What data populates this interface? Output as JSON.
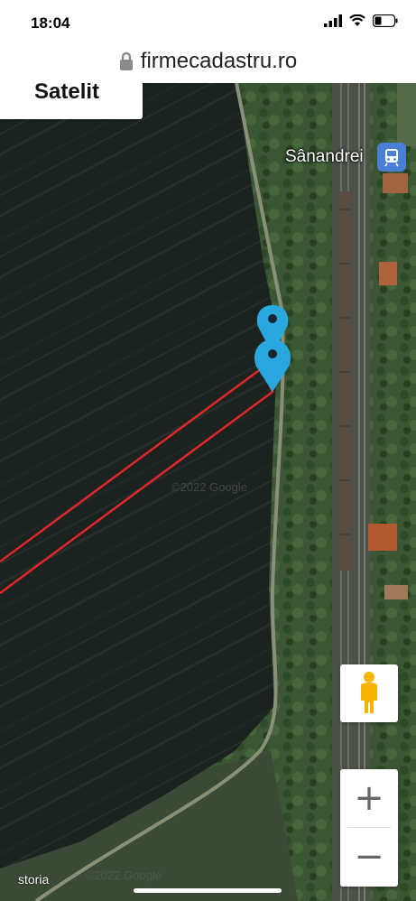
{
  "status_bar": {
    "time": "18:04"
  },
  "browser": {
    "url": "firmecadastru.ro"
  },
  "map": {
    "map_type_label": "Satelit",
    "place_label": "Sânandrei",
    "brand": "storia",
    "zoom_in": "+",
    "zoom_out": "−",
    "colors": {
      "parcel_outline": "#e0282a",
      "marker": "#29a8e0",
      "field": "#1d2420",
      "vegetation": "#3d5a34",
      "transit": "#4a7fd8"
    }
  }
}
